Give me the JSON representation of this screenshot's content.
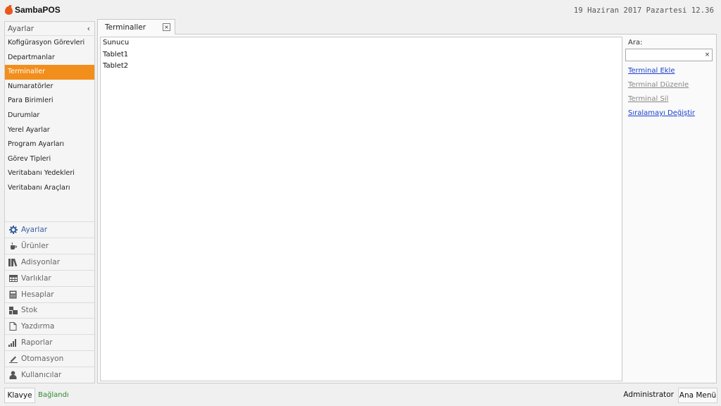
{
  "app": {
    "name": "SambaPOS",
    "datetime": "19 Haziran 2017 Pazartesi 12.36"
  },
  "left_panel": {
    "header": "Ayarlar",
    "collapse_icon": "chevron-left-icon",
    "items": [
      {
        "label": "Kofigürasyon Görevleri"
      },
      {
        "label": "Departmanlar"
      },
      {
        "label": "Terminaller",
        "active": true
      },
      {
        "label": "Numaratörler"
      },
      {
        "label": "Para Birimleri"
      },
      {
        "label": "Durumlar"
      },
      {
        "label": "Yerel Ayarlar"
      },
      {
        "label": "Program Ayarları"
      },
      {
        "label": "Görev Tipleri"
      },
      {
        "label": "Veritabanı Yedekleri"
      },
      {
        "label": "Veritabanı Araçları"
      }
    ],
    "modules": [
      {
        "label": "Ayarlar",
        "icon": "gear-icon",
        "active": true
      },
      {
        "label": "Ürünler",
        "icon": "coffee-cup-icon"
      },
      {
        "label": "Adisyonlar",
        "icon": "books-icon"
      },
      {
        "label": "Varlıklar",
        "icon": "table-icon"
      },
      {
        "label": "Hesaplar",
        "icon": "calculator-icon"
      },
      {
        "label": "Stok",
        "icon": "boxes-icon"
      },
      {
        "label": "Yazdırma",
        "icon": "document-icon"
      },
      {
        "label": "Raporlar",
        "icon": "bar-chart-icon"
      },
      {
        "label": "Otomasyon",
        "icon": "pencil-icon"
      },
      {
        "label": "Kullanıcılar",
        "icon": "user-icon"
      }
    ]
  },
  "tab": {
    "label": "Terminaller",
    "close_glyph": "×"
  },
  "terminals": [
    "Sunucu",
    "Tablet1",
    "Tablet2"
  ],
  "side": {
    "search_label": "Ara:",
    "search_value": "",
    "clear_glyph": "×",
    "actions": [
      {
        "label": "Terminal Ekle",
        "enabled": true
      },
      {
        "label": "Terminal Düzenle",
        "enabled": false
      },
      {
        "label": "Terminal Sil",
        "enabled": false
      },
      {
        "label": "Sıralamayı Değiştir",
        "enabled": true
      }
    ]
  },
  "footer": {
    "keyboard_label": "Klavye",
    "connection_status": "Bağlandı",
    "user": "Administrator",
    "main_menu_label": "Ana Menü"
  },
  "colors": {
    "accent": "#f28e1c",
    "link": "#1a3fd0",
    "connected": "#2d8a2d",
    "logo": "#e8571c"
  }
}
